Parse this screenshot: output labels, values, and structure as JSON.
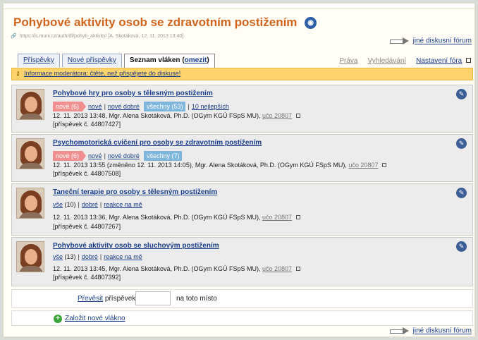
{
  "forum": {
    "title": "Pohybové aktivity osob se zdravotním postižením",
    "url": "https://is.muni.cz/auth/df/pohyb_aktivity/",
    "meta": "[A. Skotáková, 12. 11. 2013 13:40]",
    "other_forum": "jiné diskusní fórum"
  },
  "tabs": [
    {
      "label": "Příspěvky"
    },
    {
      "label": "Nové příspěvky"
    },
    {
      "label": "Seznam vláken",
      "suffix": "omezit"
    }
  ],
  "rightnav": {
    "rights": "Práva",
    "search": "Vyhledávání",
    "settings": "Nastavení fóra"
  },
  "moderator": "Informace moderátora: čtěte, než přispějete do diskuse!",
  "threads": [
    {
      "title": "Pohybové hry pro osoby s tělesným postižením",
      "new": "nové (6)",
      "new_link": "nové",
      "new_good": "nové dobré",
      "all": "všechny (53)",
      "top": "10 nejlepších",
      "info": "12. 11. 2013 13:48, Mgr. Alena Skotáková, Ph.D. (OGym KGÚ FSpS MU),",
      "uco": "učo 20807",
      "post": "[příspěvek č. 44807427]"
    },
    {
      "title": "Psychomotorická cvičení pro osoby se zdravotním postižením",
      "new": "nové (6)",
      "new_link": "nové",
      "new_good": "nové dobré",
      "all": "všechny (7)",
      "info": "12. 11. 2013 13:55 (změněno 12. 11. 2013 14:05), Mgr. Alena Skotáková, Ph.D. (OGym KGÚ FSpS MU),",
      "uco": "učo 20807",
      "post": "[příspěvek č. 44807508]"
    },
    {
      "title": "Taneční terapie pro osoby s tělesným postižením",
      "all_link": "vše",
      "count": "(10)",
      "good": "dobré",
      "replies": "reakce na mě",
      "info": "12. 11. 2013 13:36, Mgr. Alena Skotáková, Ph.D. (OGym KGÚ FSpS MU),",
      "uco": "učo 20807",
      "post": "[příspěvek č. 44807267]"
    },
    {
      "title": "Pohybové aktivity osob se sluchovým postižením",
      "all_link": "vše",
      "count": "(13)",
      "good": "dobré",
      "replies": "reakce na mě",
      "info": "12. 11. 2013 13:45, Mgr. Alena Skotáková, Ph.D. (OGym KGÚ FSpS MU),",
      "uco": "učo 20807",
      "post": "[příspěvek č. 44807392]"
    }
  ],
  "move": {
    "link": "Převěsit",
    "text1": "příspěvek č.",
    "text2": "na toto místo",
    "value": ""
  },
  "new_thread": "Založit nové vlákno"
}
